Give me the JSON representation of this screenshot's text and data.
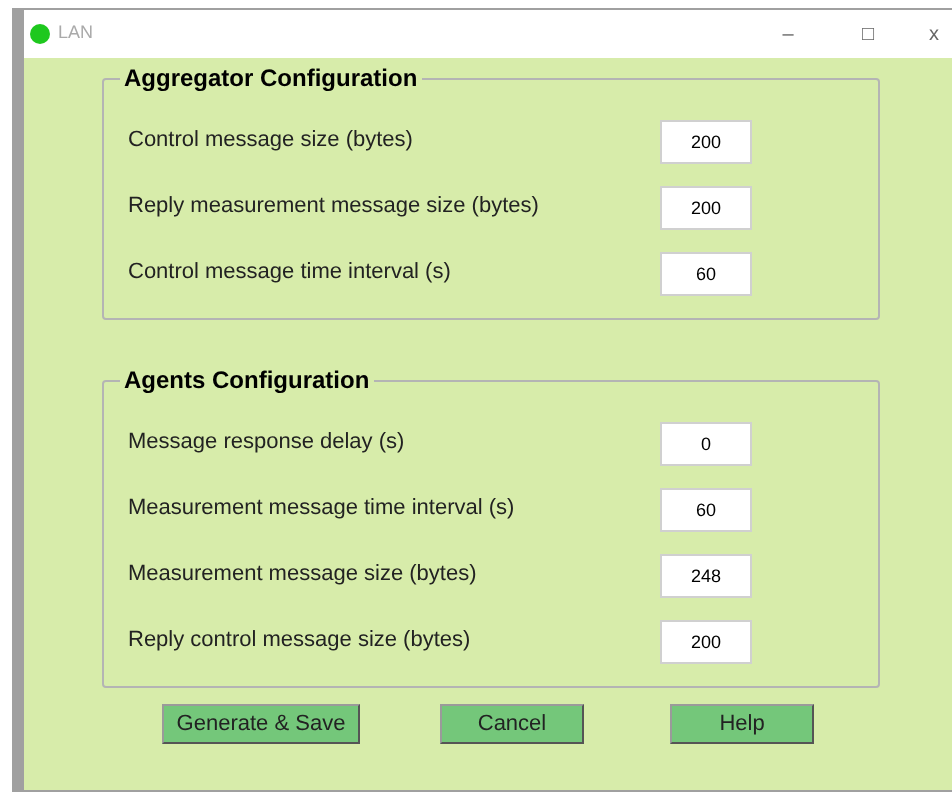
{
  "window": {
    "title": "LAN",
    "controls": [
      "–",
      "□",
      "x"
    ]
  },
  "groups": [
    {
      "title": "Aggregator Configuration",
      "fields": [
        {
          "label": "Control message size (bytes)",
          "value": "200"
        },
        {
          "label": "Reply measurement message size (bytes)",
          "value": "200"
        },
        {
          "label": "Control message time interval (s)",
          "value": "60"
        }
      ]
    },
    {
      "title": "Agents Configuration",
      "fields": [
        {
          "label": "Message response delay (s)",
          "value": "0"
        },
        {
          "label": "Measurement message time interval (s)",
          "value": "60"
        },
        {
          "label": "Measurement message size (bytes)",
          "value": "248"
        },
        {
          "label": "Reply control message size (bytes)",
          "value": "200"
        }
      ]
    }
  ],
  "buttons": [
    "Generate & Save",
    "Cancel",
    "Help"
  ]
}
